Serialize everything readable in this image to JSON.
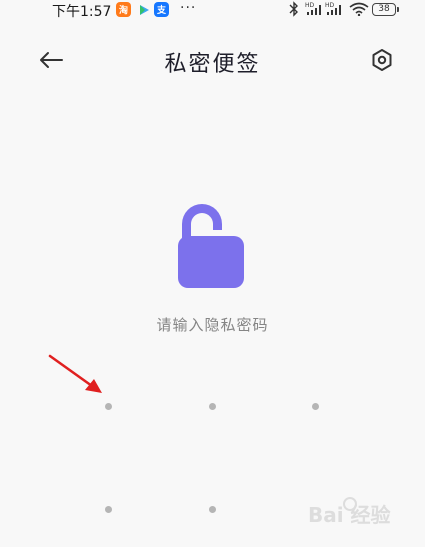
{
  "status_bar": {
    "time": "下午1:57",
    "overflow_dots": "···",
    "network_label": "HD",
    "battery": "38"
  },
  "header": {
    "title": "私密便签"
  },
  "lock": {
    "state": "unlocked",
    "color": "#7c71ec"
  },
  "prompt": {
    "text": "请输入隐私密码"
  },
  "pin_pad": {
    "rows": 2,
    "dot_color": "#b5b5b5"
  },
  "annotation": {
    "arrow_color": "#e02020"
  },
  "watermark": {
    "text": "Bai 经验"
  }
}
